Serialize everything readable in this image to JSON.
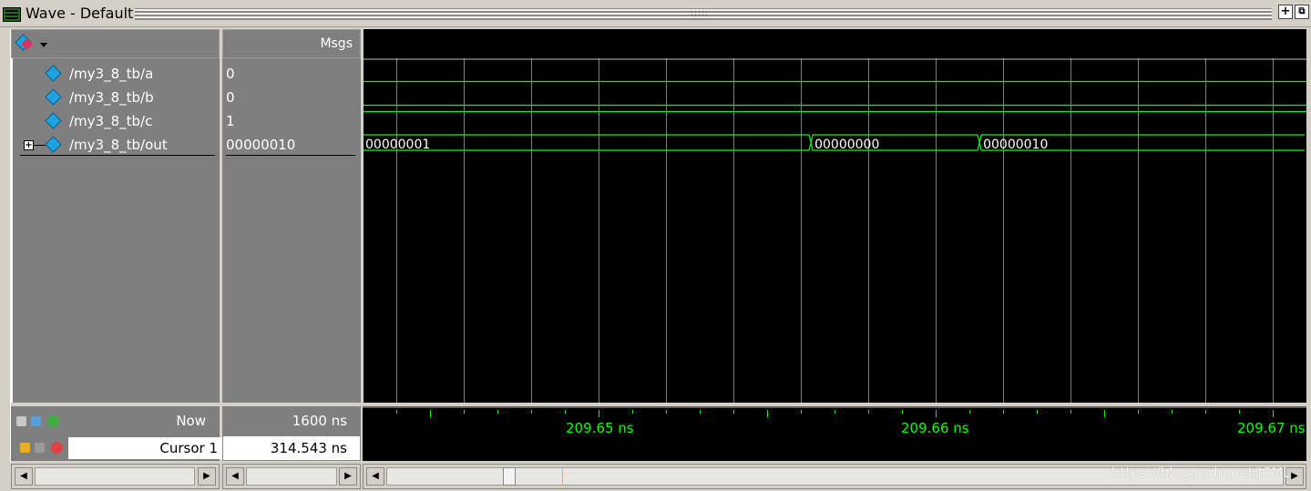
{
  "window": {
    "title": "Wave - Default"
  },
  "headers": {
    "msgs": "Msgs"
  },
  "signals": [
    {
      "name": "/my3_8_tb/a",
      "value": "0",
      "type": "wire",
      "level": 1
    },
    {
      "name": "/my3_8_tb/b",
      "value": "0",
      "type": "wire",
      "level": 0
    },
    {
      "name": "/my3_8_tb/c",
      "value": "1",
      "type": "wire",
      "level": 1
    },
    {
      "name": "/my3_8_tb/out",
      "value": "00000010",
      "type": "bus",
      "segments": [
        {
          "label": "00000001",
          "start_ns": 209.643
        },
        {
          "label": "00000000",
          "start_ns": 209.6563
        },
        {
          "label": "00000010",
          "start_ns": 209.6613
        }
      ]
    }
  ],
  "status": {
    "now_label": "Now",
    "now_value": "1600 ns",
    "cursor_label": "Cursor 1",
    "cursor_value": "314.543 ns"
  },
  "time_axis": {
    "labels": [
      "209.65 ns",
      "209.66 ns",
      "209.67 ns"
    ],
    "start_ns": 209.643,
    "end_ns": 209.671
  },
  "colors": {
    "wave": "#00ff00",
    "background": "#000000",
    "grid": "#808080",
    "panel": "#7f7f7f"
  },
  "watermark": "https://blog.csdn.net/JCML"
}
